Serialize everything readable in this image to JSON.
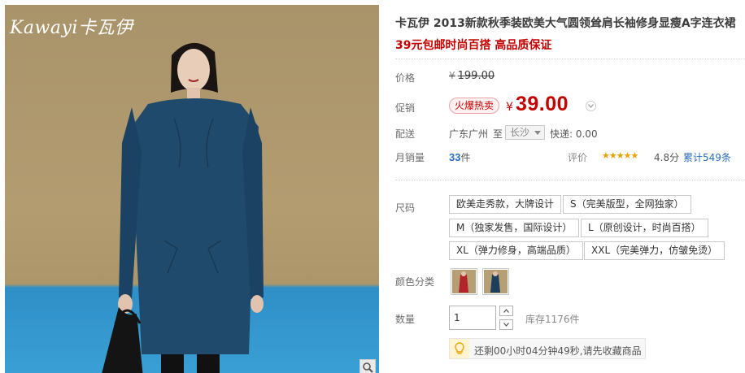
{
  "brand": {
    "logo_text": "Kawayi卡瓦伊"
  },
  "product": {
    "title": "卡瓦伊 2013新款秋季装欧美大气圆领耸肩长袖修身显瘦A字连衣裙",
    "subtitle": "39元包邮时尚百搭 高品质保证"
  },
  "price": {
    "label": "价格",
    "currency": "¥",
    "original": "199.00"
  },
  "promo": {
    "label": "促销",
    "badge": "火爆热卖",
    "currency": "¥",
    "price": "39.00"
  },
  "shipping": {
    "label": "配送",
    "from": "广东广州",
    "to_word": "至",
    "city": "长沙",
    "express": "快递: 0.00"
  },
  "sales": {
    "label": "月销量",
    "count": "33",
    "unit": "件",
    "rating_label": "评价",
    "stars": "★★★★★",
    "score": "4.8分",
    "reviews": "累计549条"
  },
  "size": {
    "label": "尺码",
    "options": [
      "欧美走秀款，大牌设计",
      "S（完美版型，全网独家）",
      "M（独家发售，国际设计）",
      "L（原创设计，时尚百搭）",
      "XL（弹力修身，高端品质）",
      "XXL（完美弹力，仿皱免烫）"
    ]
  },
  "color": {
    "label": "颜色分类",
    "options": [
      {
        "name": "red",
        "hex": "#b2232a"
      },
      {
        "name": "blue",
        "hex": "#1e3f5c"
      }
    ]
  },
  "quantity": {
    "label": "数量",
    "value": "1",
    "stock": "库存1176件"
  },
  "tip": {
    "message": "还剩00小时04分钟49秒,请先收藏商品"
  },
  "colors": {
    "price_red": "#c40000",
    "link_blue": "#2c6fbf",
    "star_gold": "#e8a200"
  }
}
